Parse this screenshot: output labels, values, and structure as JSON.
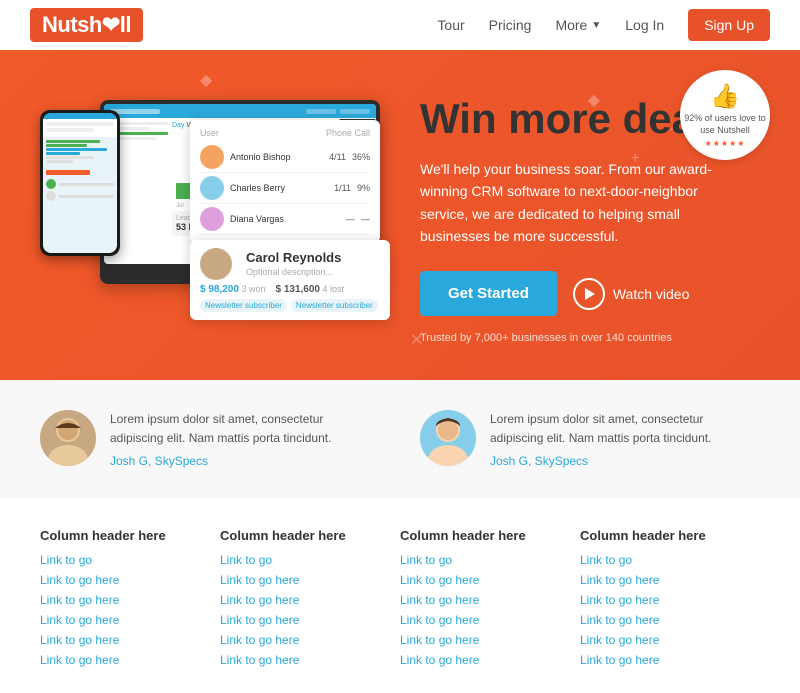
{
  "nav": {
    "logo": "Nutsh",
    "logo_suffix": "ll",
    "links": [
      "Tour",
      "Pricing",
      "More",
      "Log In"
    ],
    "cta": "Sign Up"
  },
  "hero": {
    "badge_text": "92% of users love to use Nutshell",
    "badge_stars": "★★★★★",
    "title": "Win more deals",
    "subtitle": "We'll help your business soar. From our award-winning CRM software to next-door-neighbor service, we are dedicated to helping small businesses be more successful.",
    "btn_started": "Get Started",
    "btn_watch": "Watch video",
    "trusted": "Trusted by 7,000+ businesses in over 140 countries"
  },
  "users_card": {
    "header_left": "User",
    "header_right": "Phone Call",
    "users": [
      {
        "name": "Antonio Bishop",
        "stat1": "4/11",
        "stat2": "36%"
      },
      {
        "name": "Charles Berry",
        "stat1": "1/11",
        "stat2": "9%"
      },
      {
        "name": "Diana Vargas",
        "stat1": "—",
        "stat2": "—"
      }
    ]
  },
  "contact_card": {
    "name": "Carol Reynolds",
    "desc": "Optional description...",
    "amount1": "$ 98,200",
    "label1": "3 won",
    "amount2": "$ 131,600",
    "label2": "4 lost",
    "tag1": "Newsletter subscriber",
    "tag2": "Newsletter subscriber"
  },
  "testimonials": [
    {
      "text": "Lorem ipsum dolor sit amet, consectetur adipiscing elit. Nam mattis porta tincidunt.",
      "author": "Josh G,  SkySpecs"
    },
    {
      "text": "Lorem ipsum dolor sit amet, consectetur adipiscing elit. Nam mattis porta tincidunt.",
      "author": "Josh G,  SkySpecs"
    }
  ],
  "footer_cols": [
    {
      "header": "Column header here",
      "links": [
        "Link to go",
        "Link to go here",
        "Link to go here",
        "Link to go here",
        "Link to go here",
        "Link to go here"
      ]
    },
    {
      "header": "Column header here",
      "links": [
        "Link to go",
        "Link to go here",
        "Link to go here",
        "Link to go here",
        "Link to go here",
        "Link to go here"
      ]
    },
    {
      "header": "Column header here",
      "links": [
        "Link to go",
        "Link to go here",
        "Link to go here",
        "Link to go here",
        "Link to go here",
        "Link to go here"
      ]
    },
    {
      "header": "Column header here",
      "links": [
        "Link to go",
        "Link to go here",
        "Link to go here",
        "Link to go here",
        "Link to go here",
        "Link to go here"
      ]
    }
  ],
  "colors": {
    "orange": "#f15a29",
    "teal": "#29a8dc",
    "green": "#4caf50"
  }
}
